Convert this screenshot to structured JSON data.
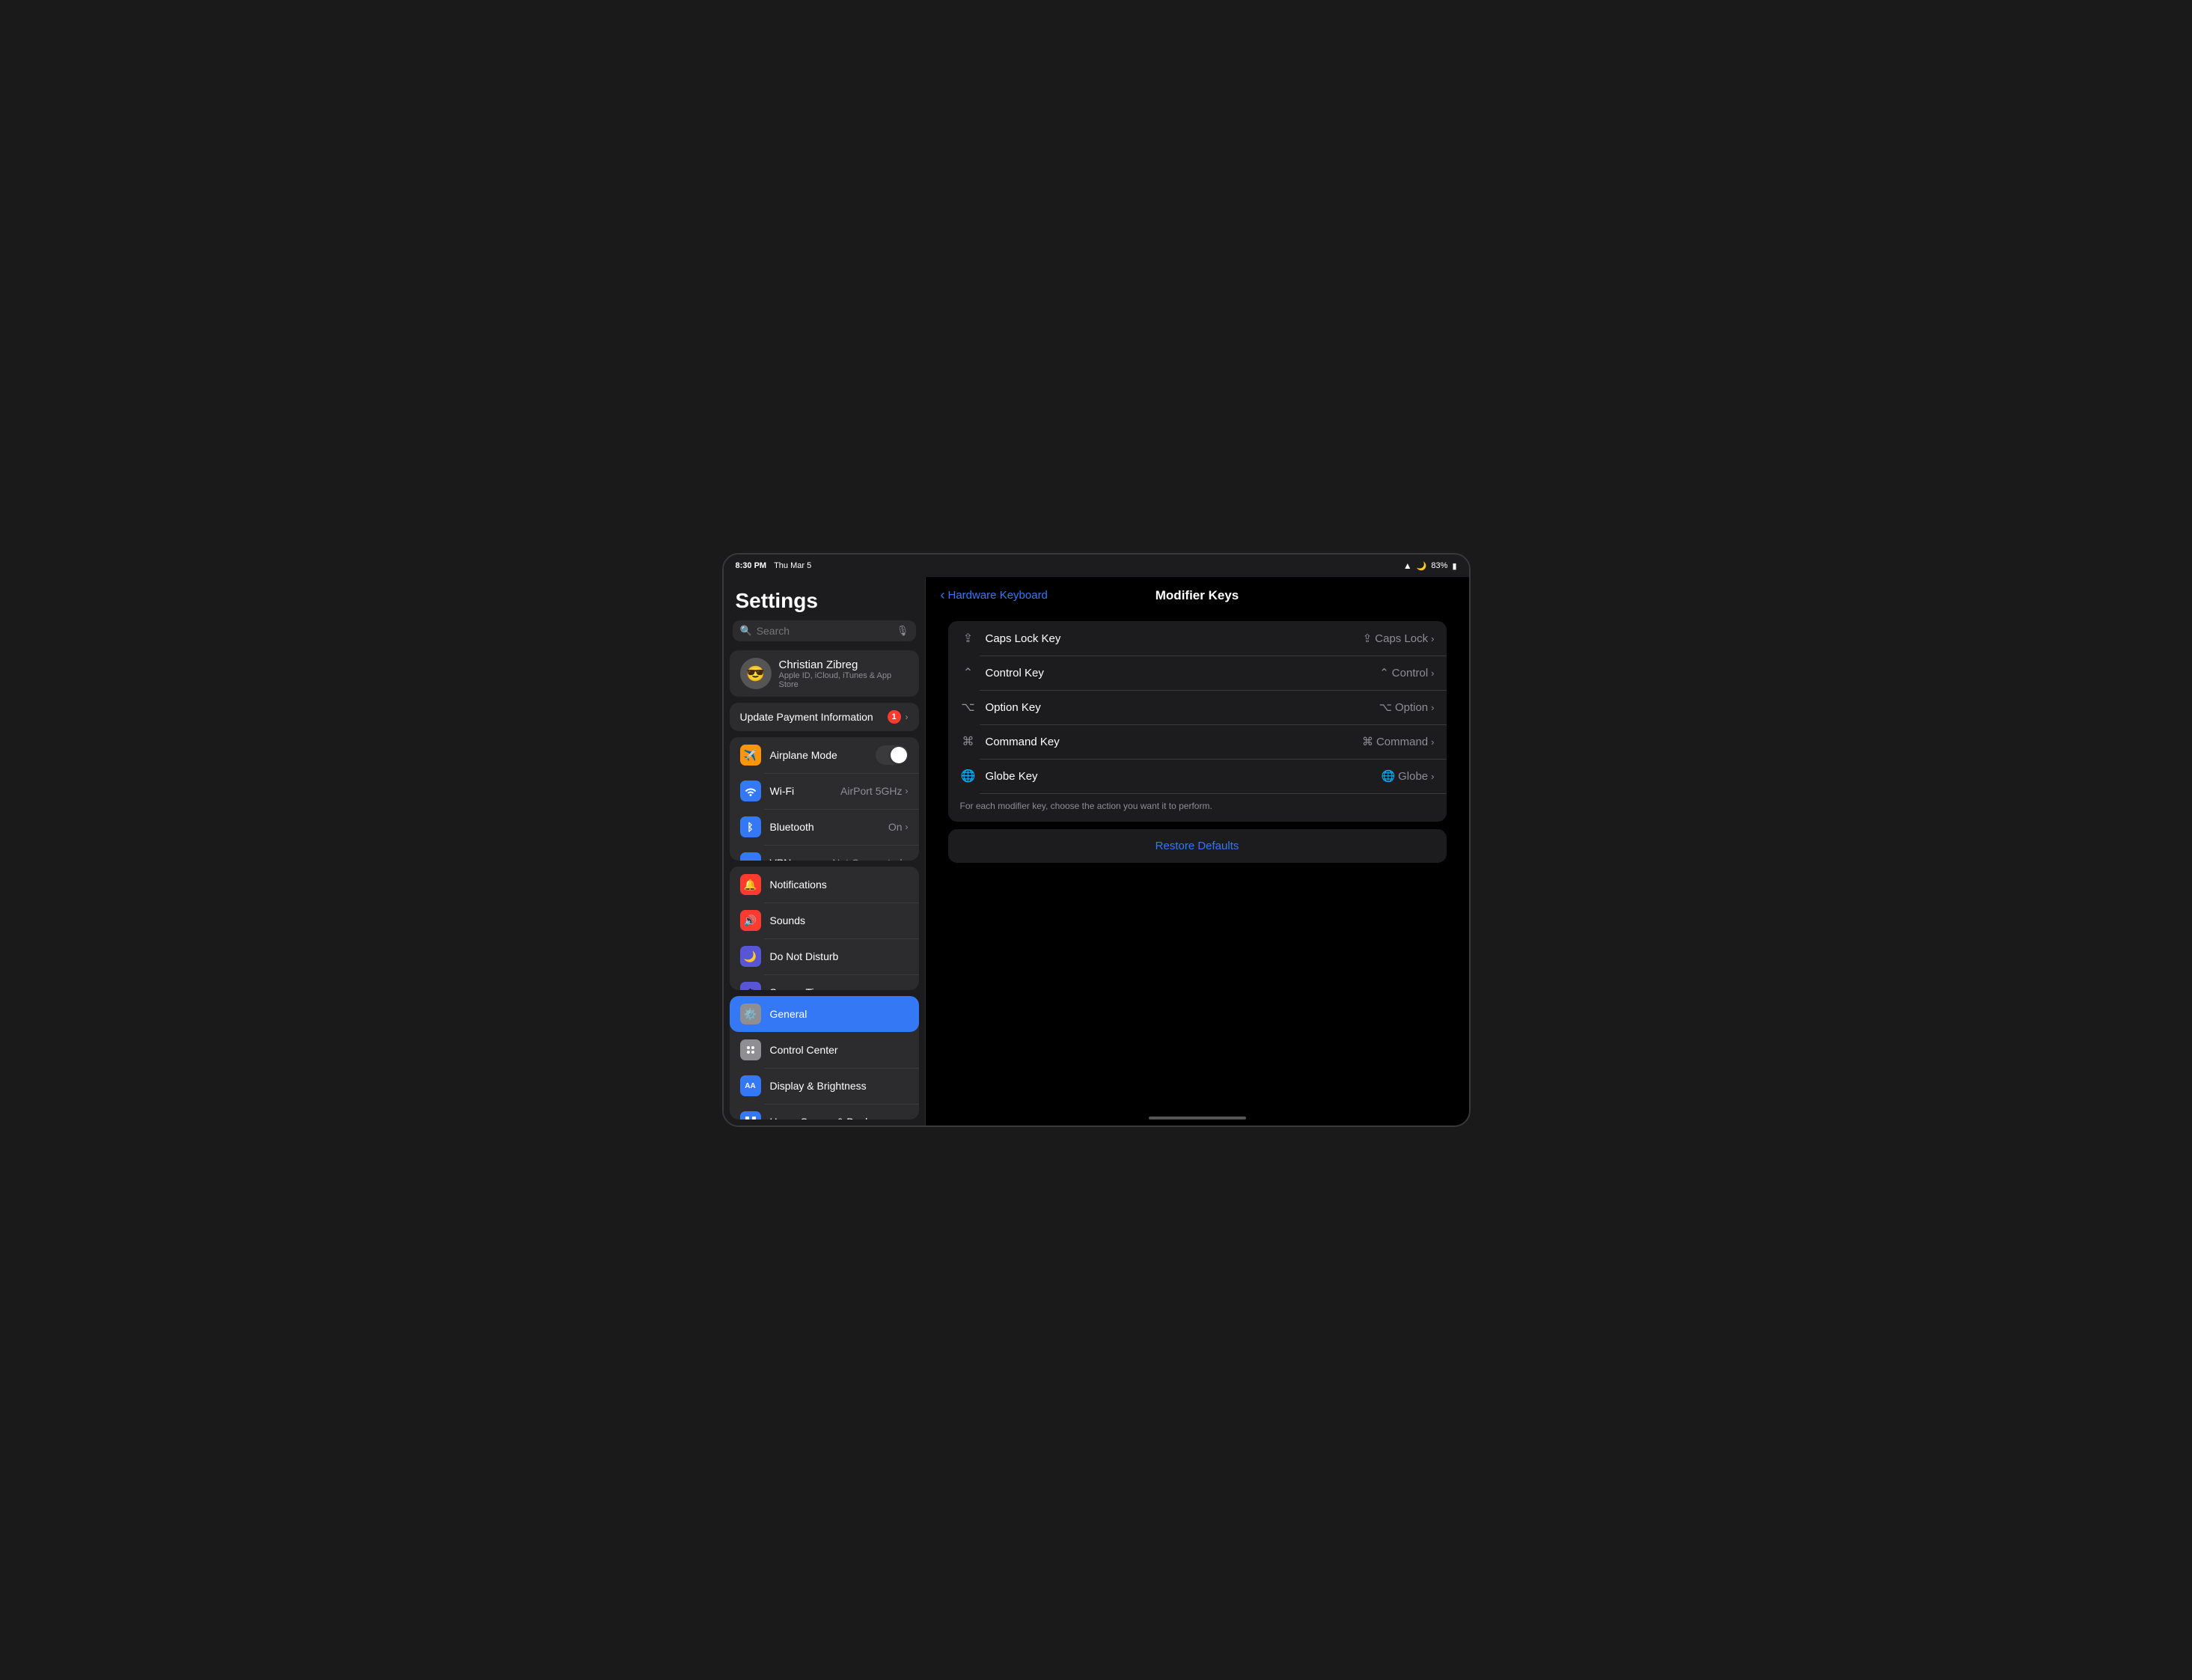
{
  "status_bar": {
    "time": "8:30 PM",
    "date": "Thu Mar 5",
    "battery": "83%",
    "wifi_icon": "📶",
    "battery_icon": "🔋"
  },
  "sidebar": {
    "title": "Settings",
    "search_placeholder": "Search",
    "user": {
      "name": "Christian Zibreg",
      "subtitle": "Apple ID, iCloud, iTunes & App Store",
      "avatar_emoji": "😎"
    },
    "payment_banner": {
      "label": "Update Payment Information",
      "badge": "1"
    },
    "network_group": [
      {
        "id": "airplane-mode",
        "label": "Airplane Mode",
        "icon_emoji": "✈️",
        "icon_bg": "#ff9500",
        "has_toggle": true,
        "toggle_on": false,
        "value": ""
      },
      {
        "id": "wifi",
        "label": "Wi-Fi",
        "icon_emoji": "📶",
        "icon_bg": "#3478f6",
        "has_toggle": false,
        "value": "AirPort 5GHz"
      },
      {
        "id": "bluetooth",
        "label": "Bluetooth",
        "icon_emoji": "🔵",
        "icon_bg": "#3478f6",
        "has_toggle": false,
        "value": "On"
      },
      {
        "id": "vpn",
        "label": "VPN",
        "icon_text": "VPN",
        "icon_bg": "#3478f6",
        "has_toggle": false,
        "value": "Not Connected"
      }
    ],
    "system_group": [
      {
        "id": "notifications",
        "label": "Notifications",
        "icon_emoji": "🔔",
        "icon_bg": "#ff3b30",
        "value": ""
      },
      {
        "id": "sounds",
        "label": "Sounds",
        "icon_emoji": "🔊",
        "icon_bg": "#ff3b30",
        "value": ""
      },
      {
        "id": "do-not-disturb",
        "label": "Do Not Disturb",
        "icon_emoji": "🌙",
        "icon_bg": "#5856d6",
        "value": ""
      },
      {
        "id": "screen-time",
        "label": "Screen Time",
        "icon_emoji": "⏱",
        "icon_bg": "#5856d6",
        "value": ""
      }
    ],
    "app_group": [
      {
        "id": "general",
        "label": "General",
        "icon_emoji": "⚙️",
        "icon_bg": "#8e8e93",
        "active": true,
        "value": ""
      },
      {
        "id": "control-center",
        "label": "Control Center",
        "icon_emoji": "⊞",
        "icon_bg": "#8e8e93",
        "value": ""
      },
      {
        "id": "display-brightness",
        "label": "Display & Brightness",
        "icon_emoji": "AA",
        "icon_bg": "#3478f6",
        "value": ""
      },
      {
        "id": "home-screen-dock",
        "label": "Home Screen & Dock",
        "icon_emoji": "⊞",
        "icon_bg": "#3478f6",
        "value": ""
      }
    ]
  },
  "right_panel": {
    "back_label": "Hardware Keyboard",
    "page_title": "Modifier Keys",
    "modifier_keys": [
      {
        "id": "caps-lock-key",
        "icon": "⇪",
        "label": "Caps Lock Key",
        "value_icon": "⇪",
        "value": "Caps Lock"
      },
      {
        "id": "control-key",
        "icon": "⌃",
        "label": "Control Key",
        "value_icon": "⌃",
        "value": "Control"
      },
      {
        "id": "option-key",
        "icon": "⌥",
        "label": "Option Key",
        "value_icon": "⌥",
        "value": "Option"
      },
      {
        "id": "command-key",
        "icon": "⌘",
        "label": "Command Key",
        "value_icon": "⌘",
        "value": "Command"
      },
      {
        "id": "globe-key",
        "icon": "🌐",
        "label": "Globe Key",
        "value_icon": "🌐",
        "value": "Globe"
      }
    ],
    "hint_text": "For each modifier key, choose the action you want it to perform.",
    "restore_defaults_label": "Restore Defaults"
  }
}
